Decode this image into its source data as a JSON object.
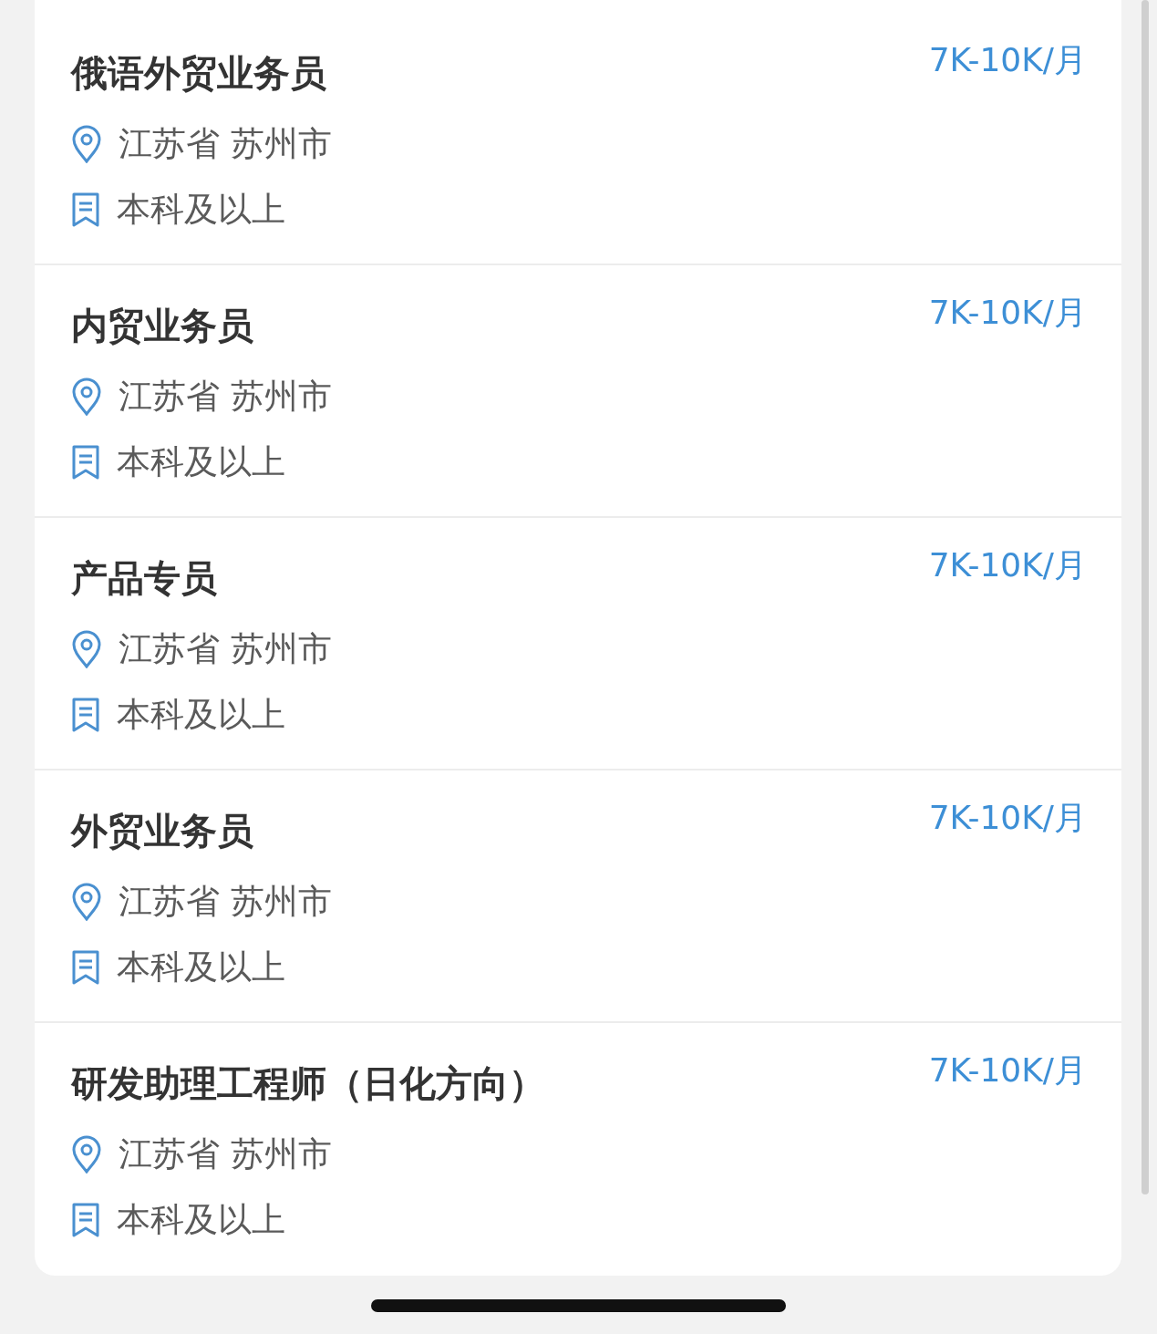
{
  "jobs": [
    {
      "title": "俄语外贸业务员",
      "salary": "7K-10K/月",
      "location": "江苏省 苏州市",
      "education": "本科及以上"
    },
    {
      "title": "内贸业务员",
      "salary": "7K-10K/月",
      "location": "江苏省 苏州市",
      "education": "本科及以上"
    },
    {
      "title": "产品专员",
      "salary": "7K-10K/月",
      "location": "江苏省 苏州市",
      "education": "本科及以上"
    },
    {
      "title": "外贸业务员",
      "salary": "7K-10K/月",
      "location": "江苏省 苏州市",
      "education": "本科及以上"
    },
    {
      "title": "研发助理工程师（日化方向）",
      "salary": "7K-10K/月",
      "location": "江苏省 苏州市",
      "education": "本科及以上"
    }
  ]
}
